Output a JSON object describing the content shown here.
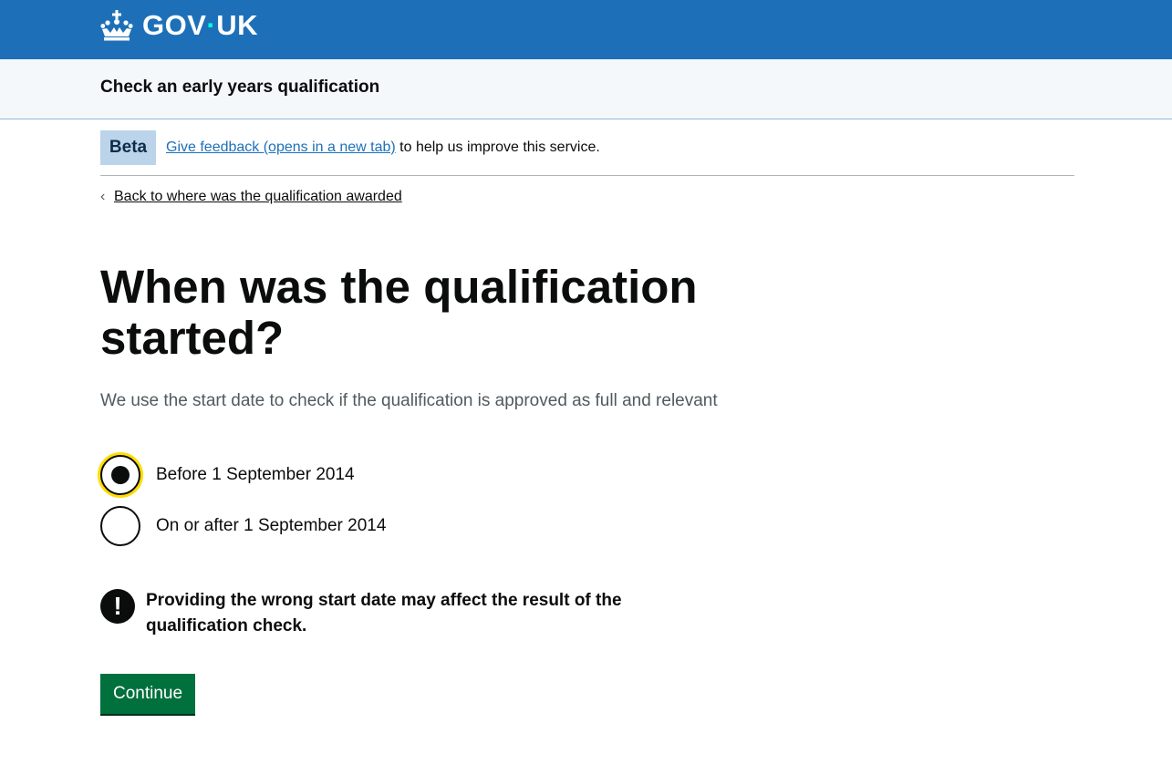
{
  "header": {
    "logo_text_left": "GOV",
    "logo_dot": "·",
    "logo_text_right": "UK",
    "icon": "crown-icon"
  },
  "service": {
    "name": "Check an early years qualification"
  },
  "phase_banner": {
    "tag": "Beta",
    "link_text": "Give feedback (opens in a new tab)",
    "text_after": " to help us improve this service."
  },
  "back_link": {
    "label": "Back to where was the qualification awarded"
  },
  "question": {
    "title": "When was the qualification started?",
    "hint": "We use the start date to check if the qualification is approved as full and relevant",
    "options": [
      {
        "label": "Before 1 September 2014",
        "selected": true
      },
      {
        "label": "On or after 1 September 2014",
        "selected": false
      }
    ]
  },
  "warning": {
    "icon_glyph": "!",
    "text": "Providing the wrong start date may affect the result of the qualification check."
  },
  "continue_button": {
    "label": "Continue"
  },
  "colors": {
    "header_blue": "#1d70b8",
    "button_green": "#00703c",
    "focus_yellow": "#ffdd00",
    "link_blue": "#1d70b8"
  }
}
